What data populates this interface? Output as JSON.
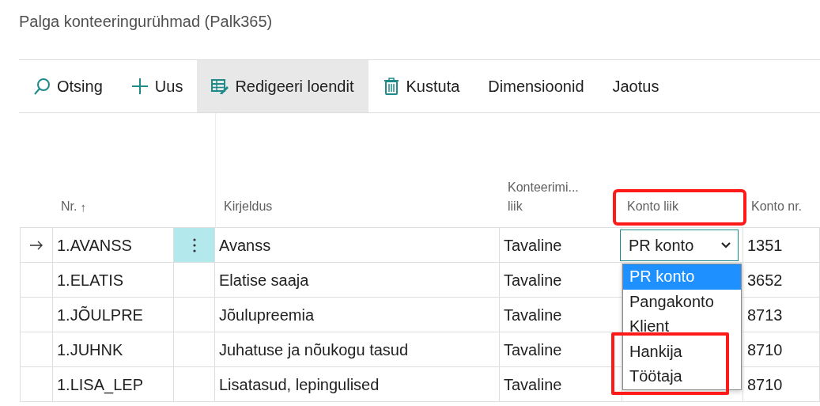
{
  "page_title": "Palga konteeringurühmad (Palk365)",
  "toolbar": [
    {
      "label": "Otsing",
      "kind": "search",
      "active": false
    },
    {
      "label": "Uus",
      "kind": "plus",
      "active": false
    },
    {
      "label": "Redigeeri loendit",
      "kind": "editlist",
      "active": true
    },
    {
      "label": "Kustuta",
      "kind": "trash",
      "active": false
    },
    {
      "label": "Dimensioonid",
      "kind": "text",
      "active": false
    },
    {
      "label": "Jaotus",
      "kind": "text",
      "active": false
    }
  ],
  "table": {
    "columns": [
      {
        "label": "Nr.",
        "sort_mark": "↑",
        "highlighted": false
      },
      {
        "label": "Kirjeldus",
        "highlighted": false
      },
      {
        "label": "Konteerimi...",
        "label_2": "liik",
        "highlighted": false
      },
      {
        "label": "Konto liik",
        "highlighted": true
      },
      {
        "label": "Konto nr.",
        "highlighted": false
      }
    ],
    "rows": [
      {
        "selected": true,
        "nr": "1.AVANSS",
        "kirjeldus": "Avanss",
        "konteerimis_liik": "Tavaline",
        "konto_liik": "PR konto",
        "konto_nr": "1351"
      },
      {
        "selected": false,
        "nr": "1.ELATIS",
        "kirjeldus": "Elatise saaja",
        "konteerimis_liik": "Tavaline",
        "konto_nr": "3652"
      },
      {
        "selected": false,
        "nr": "1.JÕULPRE",
        "kirjeldus": "Jõulupreemia",
        "konteerimis_liik": "Tavaline",
        "konto_nr": "8713"
      },
      {
        "selected": false,
        "nr": "1.JUHNK",
        "kirjeldus": "Juhatuse ja nõukogu tasud",
        "konteerimis_liik": "Tavaline",
        "konto_nr": "8710"
      },
      {
        "selected": false,
        "nr": "1.LISA_LEP",
        "kirjeldus": "Lisatasud, lepingulised",
        "konteerimis_liik": "Tavaline",
        "konto_nr": "8710"
      }
    ]
  },
  "dropdown": {
    "options": [
      {
        "label": "PR konto",
        "selected": true,
        "highlighted": false
      },
      {
        "label": "Pangakonto",
        "selected": false,
        "highlighted": false
      },
      {
        "label": "Klient",
        "selected": false,
        "highlighted": false
      },
      {
        "label": "Hankija",
        "selected": false,
        "highlighted": true
      },
      {
        "label": "Töötaja",
        "selected": false,
        "highlighted": true
      }
    ]
  }
}
